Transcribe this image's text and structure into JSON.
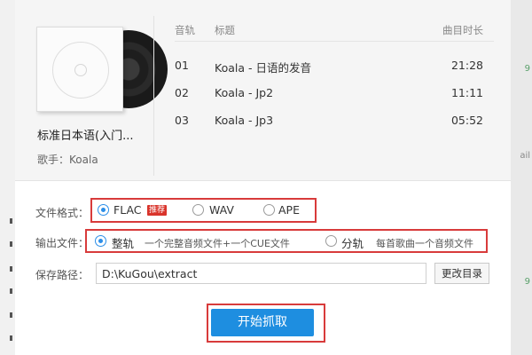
{
  "background": {
    "right_marks": [
      "9",
      "ail",
      "9"
    ]
  },
  "album": {
    "title": "标准日本语(入门...",
    "artist_label": "歌手：",
    "artist": "Koala"
  },
  "track_table": {
    "headers": {
      "num": "音轨",
      "title": "标题",
      "duration": "曲目时长"
    },
    "rows": [
      {
        "num": "01",
        "title": "Koala - 日语的发音",
        "duration": "21:28"
      },
      {
        "num": "02",
        "title": "Koala - Jp2",
        "duration": "11:11"
      },
      {
        "num": "03",
        "title": "Koala - Jp3",
        "duration": "05:52"
      }
    ]
  },
  "format": {
    "label": "文件格式：",
    "options": [
      {
        "label": "FLAC",
        "selected": true,
        "badge": "推荐"
      },
      {
        "label": "WAV",
        "selected": false
      },
      {
        "label": "APE",
        "selected": false
      }
    ]
  },
  "output": {
    "label": "输出文件：",
    "options": [
      {
        "label": "整轨",
        "hint": "一个完整音频文件+一个CUE文件",
        "selected": true
      },
      {
        "label": "分轨",
        "hint": "每首歌曲一个音频文件",
        "selected": false
      }
    ]
  },
  "save_path": {
    "label": "保存路径：",
    "value": "D:\\KuGou\\extract",
    "change_button": "更改目录"
  },
  "start_button": "开始抓取",
  "colors": {
    "accent": "#1e8ee0",
    "radio_selected": "#2b8ee8",
    "highlight_box": "#d83b3b",
    "badge": "#d9342b"
  }
}
